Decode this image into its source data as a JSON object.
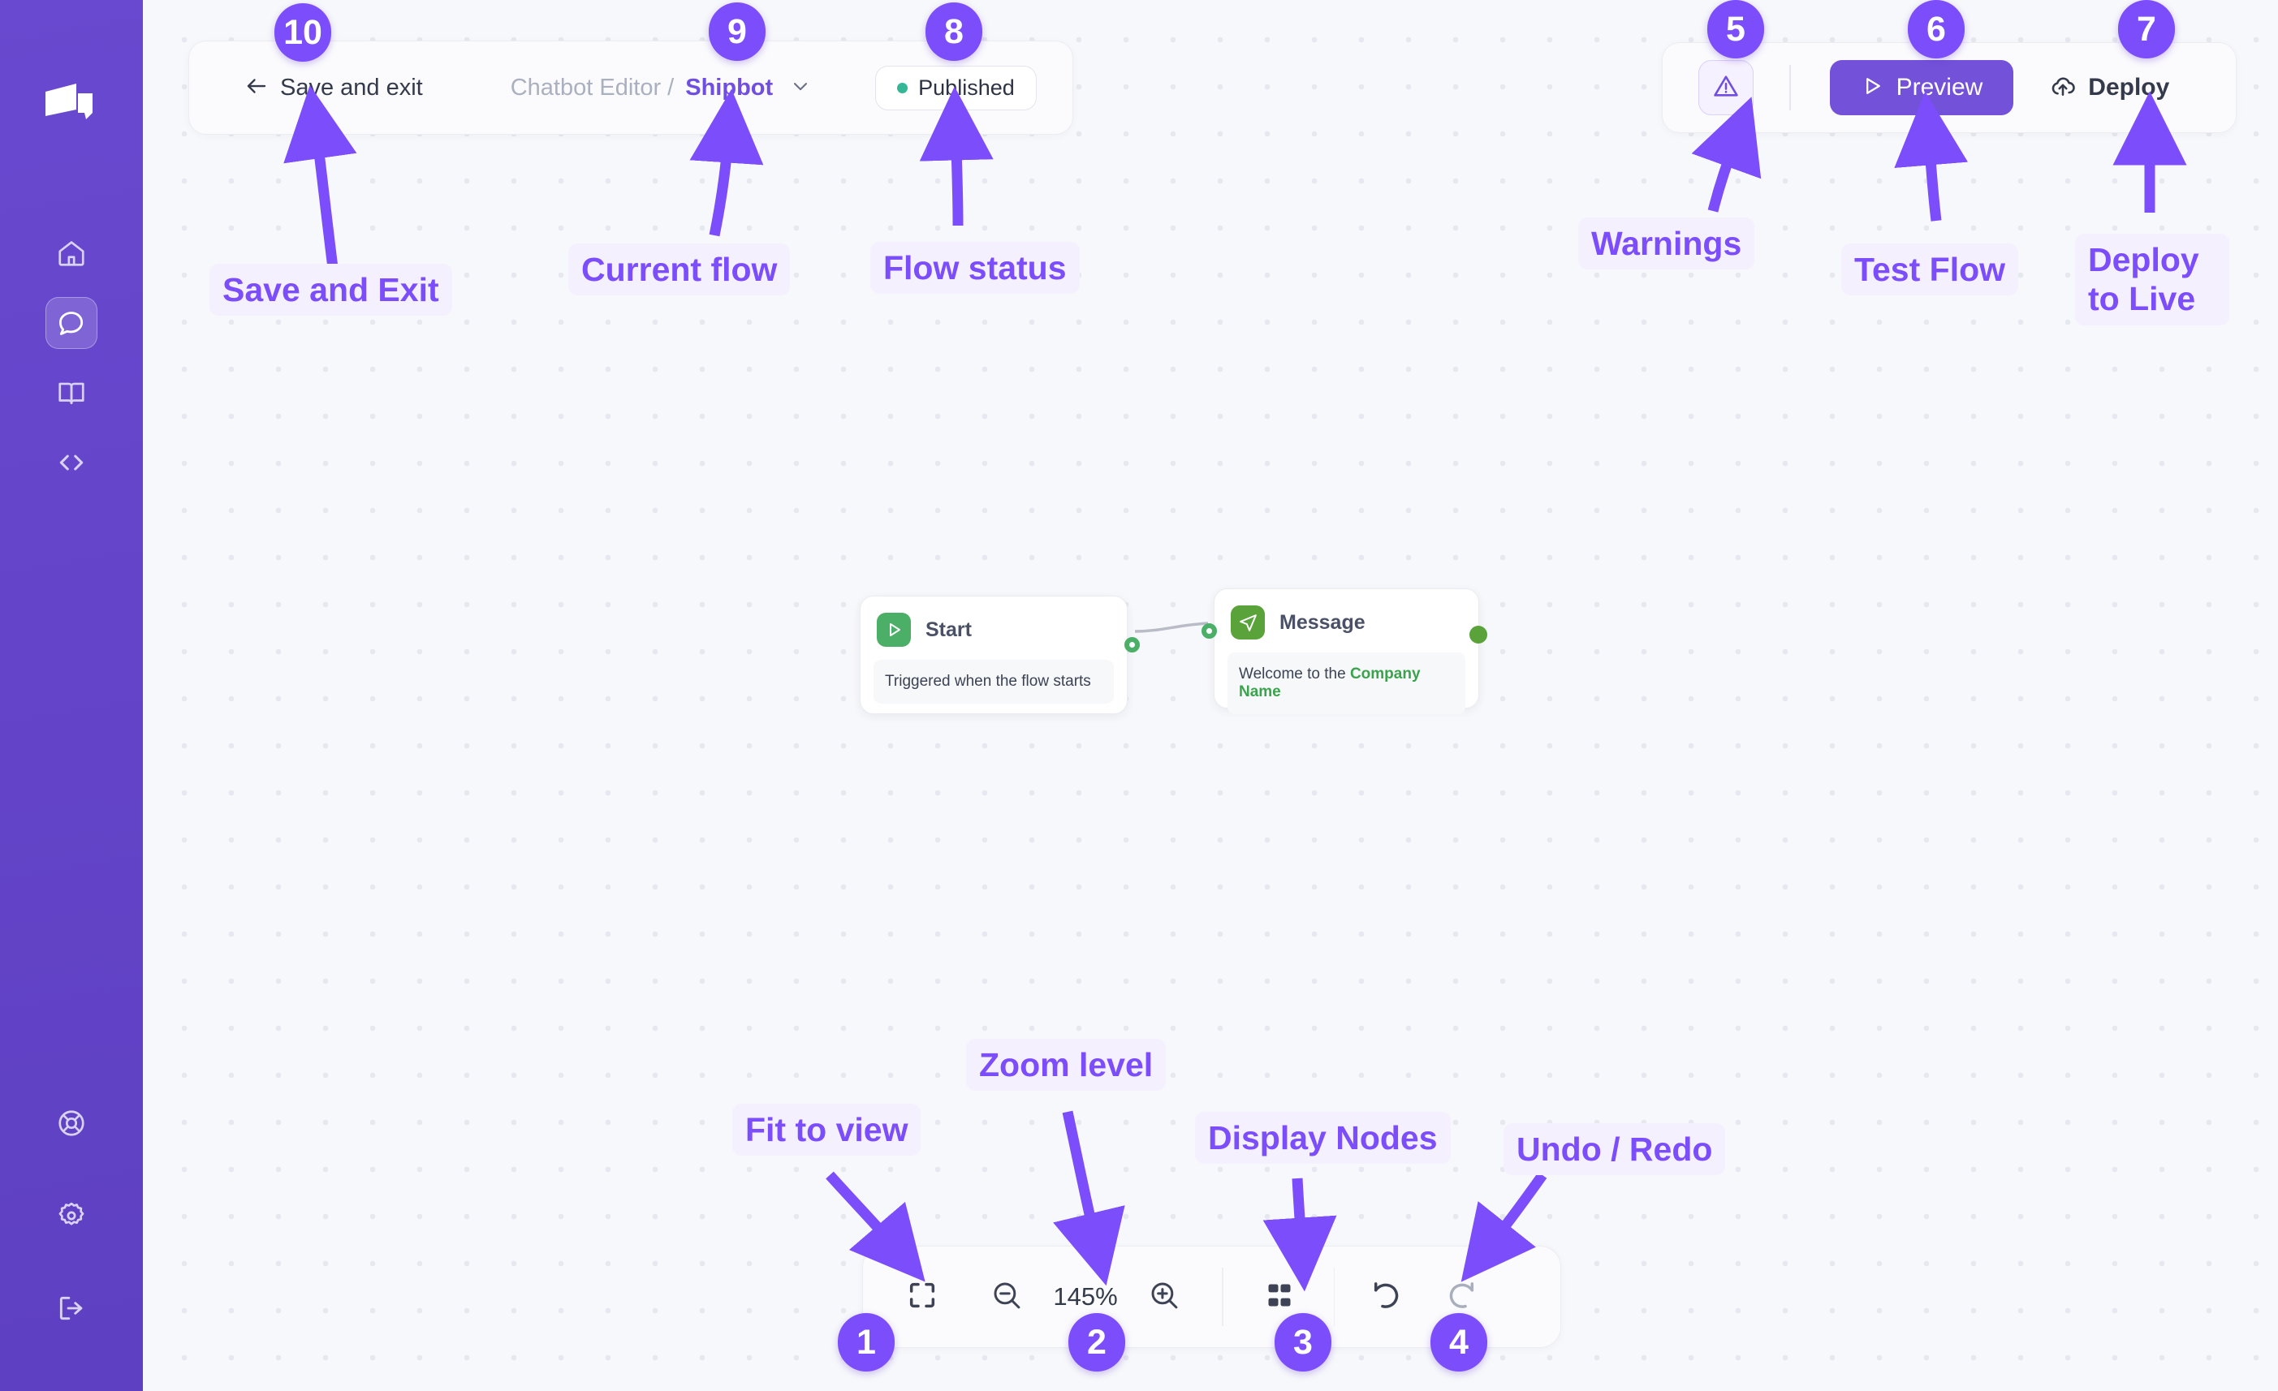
{
  "app": {
    "sidebar": {
      "logo_icon": "chatbot-logo-icon",
      "top_items": [
        {
          "name": "home",
          "icon": "home-icon",
          "active": false
        },
        {
          "name": "chatbot",
          "icon": "chat-bubble-icon",
          "active": true
        },
        {
          "name": "knowledge-base",
          "icon": "book-icon",
          "active": false
        },
        {
          "name": "developers",
          "icon": "code-brackets-icon",
          "active": false
        }
      ],
      "bottom_items": [
        {
          "name": "support",
          "icon": "lifebuoy-icon"
        },
        {
          "name": "settings",
          "icon": "gear-icon"
        },
        {
          "name": "logout",
          "icon": "logout-icon"
        }
      ]
    },
    "header": {
      "back_icon": "arrow-left-icon",
      "save_exit_label": "Save and exit",
      "breadcrumb_root": "Chatbot Editor /",
      "breadcrumb_current": "Shipbot",
      "breadcrumb_chevron_icon": "chevron-down-icon",
      "status": {
        "label": "Published",
        "dot_color": "#35b795"
      }
    },
    "right_toolbar": {
      "warnings_icon": "warning-triangle-icon",
      "preview_label": "Preview",
      "preview_icon": "play-triangle-icon",
      "preview_bg": "#7352d9",
      "deploy_label": "Deploy",
      "deploy_icon": "cloud-upload-icon"
    },
    "bottom_toolbar": {
      "fit_to_view_icon": "fit-to-view-icon",
      "zoom_out_icon": "zoom-out-icon",
      "zoom_level": "145%",
      "zoom_in_icon": "zoom-in-icon",
      "display_nodes_icon": "grid-squares-icon",
      "undo_icon": "undo-arrow-icon",
      "redo_icon": "redo-arrow-icon"
    },
    "canvas": {
      "nodes": [
        {
          "id": "start",
          "title": "Start",
          "icon": "play-triangle-icon",
          "icon_bg": "#4caf68",
          "body_text": "Triggered when the flow starts"
        },
        {
          "id": "message",
          "title": "Message",
          "icon": "paper-plane-icon",
          "icon_bg": "#5aa23a",
          "body_prefix": "Welcome to the ",
          "body_variable": "Company Name"
        }
      ]
    },
    "annotations": {
      "accent": "#7c4dfb",
      "label_bg": "#f5f0fe",
      "items": [
        {
          "number": "10",
          "label": "Save and Exit"
        },
        {
          "number": "9",
          "label": "Current flow"
        },
        {
          "number": "8",
          "label": "Flow status"
        },
        {
          "number": "5",
          "label": "Warnings"
        },
        {
          "number": "6",
          "label": "Test Flow"
        },
        {
          "number": "7",
          "label": "Deploy to Live"
        },
        {
          "number": "1",
          "label": "Fit to view"
        },
        {
          "number": "2",
          "label": "Zoom level"
        },
        {
          "number": "3",
          "label": "Display Nodes"
        },
        {
          "number": "4",
          "label": "Undo / Redo"
        }
      ]
    }
  }
}
